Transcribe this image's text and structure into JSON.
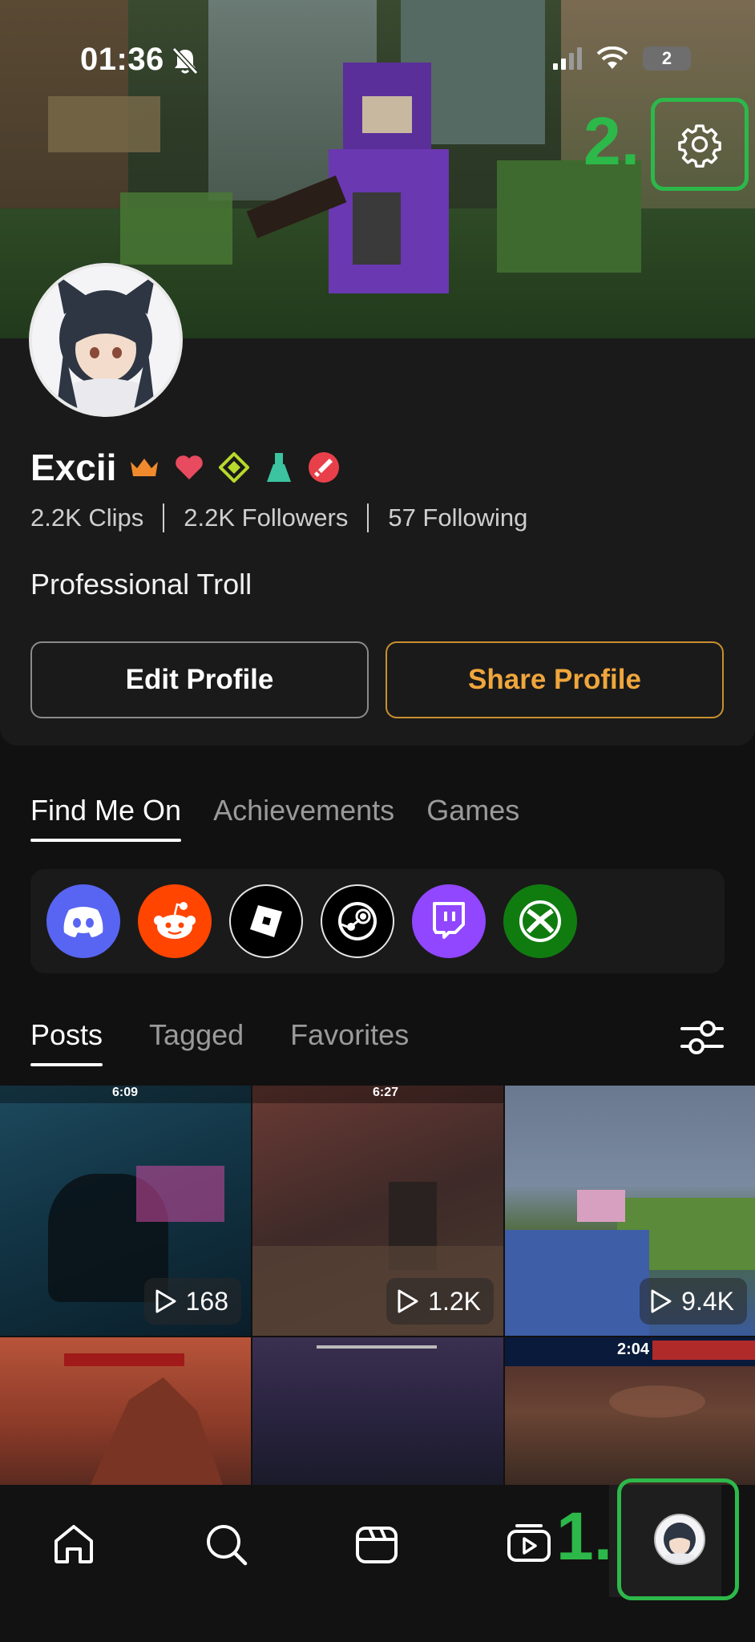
{
  "status_bar": {
    "time": "01:36",
    "battery": "2"
  },
  "callouts": {
    "settings": "2.",
    "profile_tab": "1."
  },
  "profile": {
    "name": "Excii",
    "stats": {
      "clips": "2.2K Clips",
      "followers": "2.2K Followers",
      "following": "57 Following"
    },
    "bio": "Professional Troll",
    "badges": [
      "crown-badge",
      "heart-badge",
      "diamond-badge",
      "flask-badge",
      "sword-badge"
    ]
  },
  "buttons": {
    "edit": "Edit Profile",
    "share": "Share Profile"
  },
  "profile_tabs": [
    "Find Me On",
    "Achievements",
    "Games"
  ],
  "socials": [
    {
      "name": "discord-icon",
      "color": "#5865F2"
    },
    {
      "name": "reddit-icon",
      "color": "#FF4500"
    },
    {
      "name": "roblox-icon",
      "color": "#000000"
    },
    {
      "name": "steam-icon",
      "color": "#000000"
    },
    {
      "name": "twitch-icon",
      "color": "#9146FF"
    },
    {
      "name": "xbox-icon",
      "color": "#107C10"
    }
  ],
  "post_tabs": [
    "Posts",
    "Tagged",
    "Favorites"
  ],
  "posts": [
    {
      "views": "168",
      "hud_time": "6:09",
      "theme": "valorant-blue"
    },
    {
      "views": "1.2K",
      "hud_time": "6:27",
      "theme": "valorant-warm"
    },
    {
      "views": "9.4K",
      "hud_time": "",
      "theme": "minecraft"
    },
    {
      "views": "",
      "hud_time": "",
      "theme": "mars"
    },
    {
      "views": "",
      "hud_time": "",
      "theme": "space"
    },
    {
      "views": "",
      "hud_time": "2:04",
      "theme": "indoor"
    }
  ],
  "bottom_nav": [
    "home-icon",
    "search-icon",
    "clips-icon",
    "video-icon",
    "profile-avatar"
  ],
  "colors": {
    "accent_orange": "#F0A63C",
    "highlight_green": "#2DB84A",
    "background": "#111111"
  }
}
